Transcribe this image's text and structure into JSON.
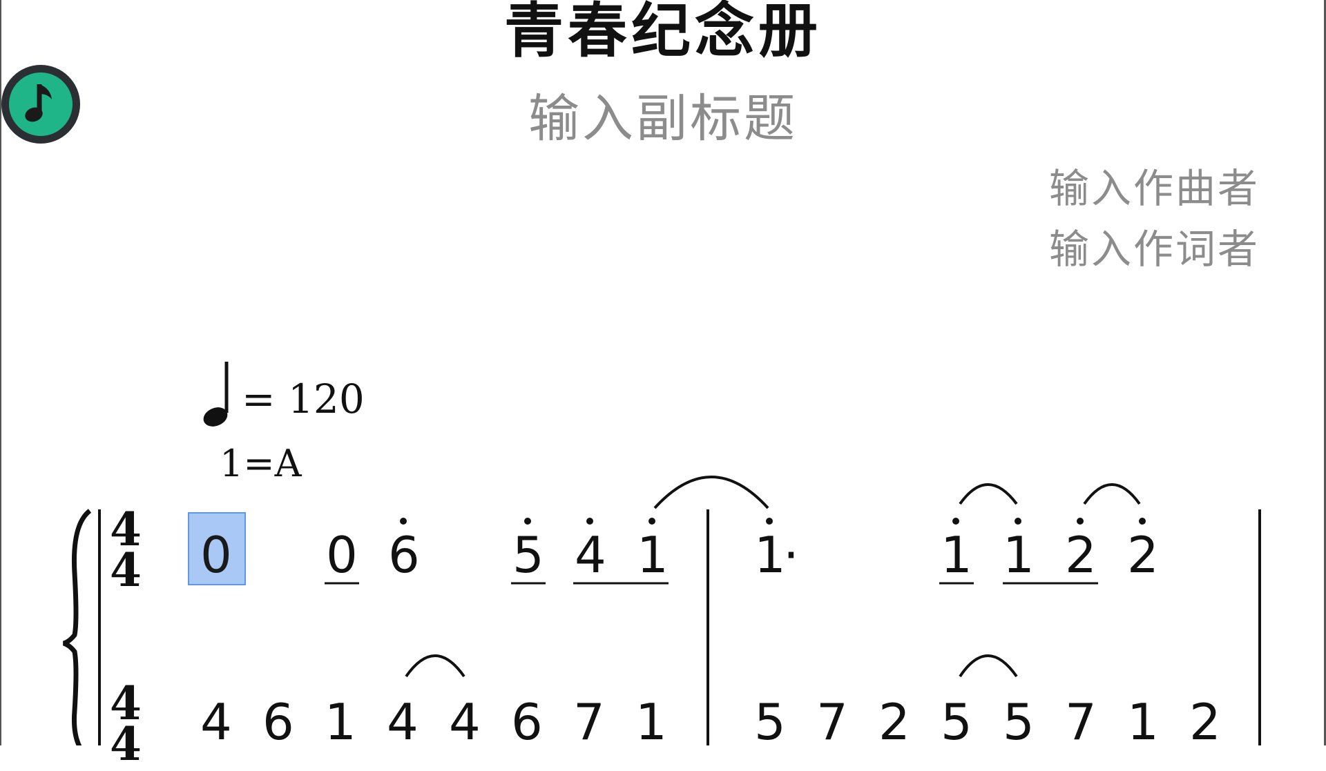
{
  "score": {
    "title": "青春纪念册",
    "subtitle": "输入副标题",
    "composer": "输入作曲者",
    "lyricist": "输入作词者",
    "tempo": "= 120",
    "key": "1=A",
    "time_signature": {
      "top": "4",
      "bottom": "4"
    }
  },
  "upper_staff": {
    "measure1": [
      "0",
      "0",
      "6",
      "5",
      "4",
      "1"
    ],
    "measure2": [
      "1",
      "·",
      "1",
      "1",
      "2",
      "2"
    ]
  },
  "lower_staff": {
    "measure1": [
      "4",
      "6",
      "1",
      "4",
      "4",
      "6",
      "7",
      "1"
    ],
    "measure2": [
      "5",
      "7",
      "2",
      "5",
      "5",
      "7",
      "1",
      "2"
    ]
  },
  "colors": {
    "accent": "#1fb588",
    "selection": "#a9c8f5",
    "muted_text": "#8c8c8c"
  },
  "icons": {
    "app": "music-note-icon",
    "tempo": "quarter-note-icon"
  }
}
